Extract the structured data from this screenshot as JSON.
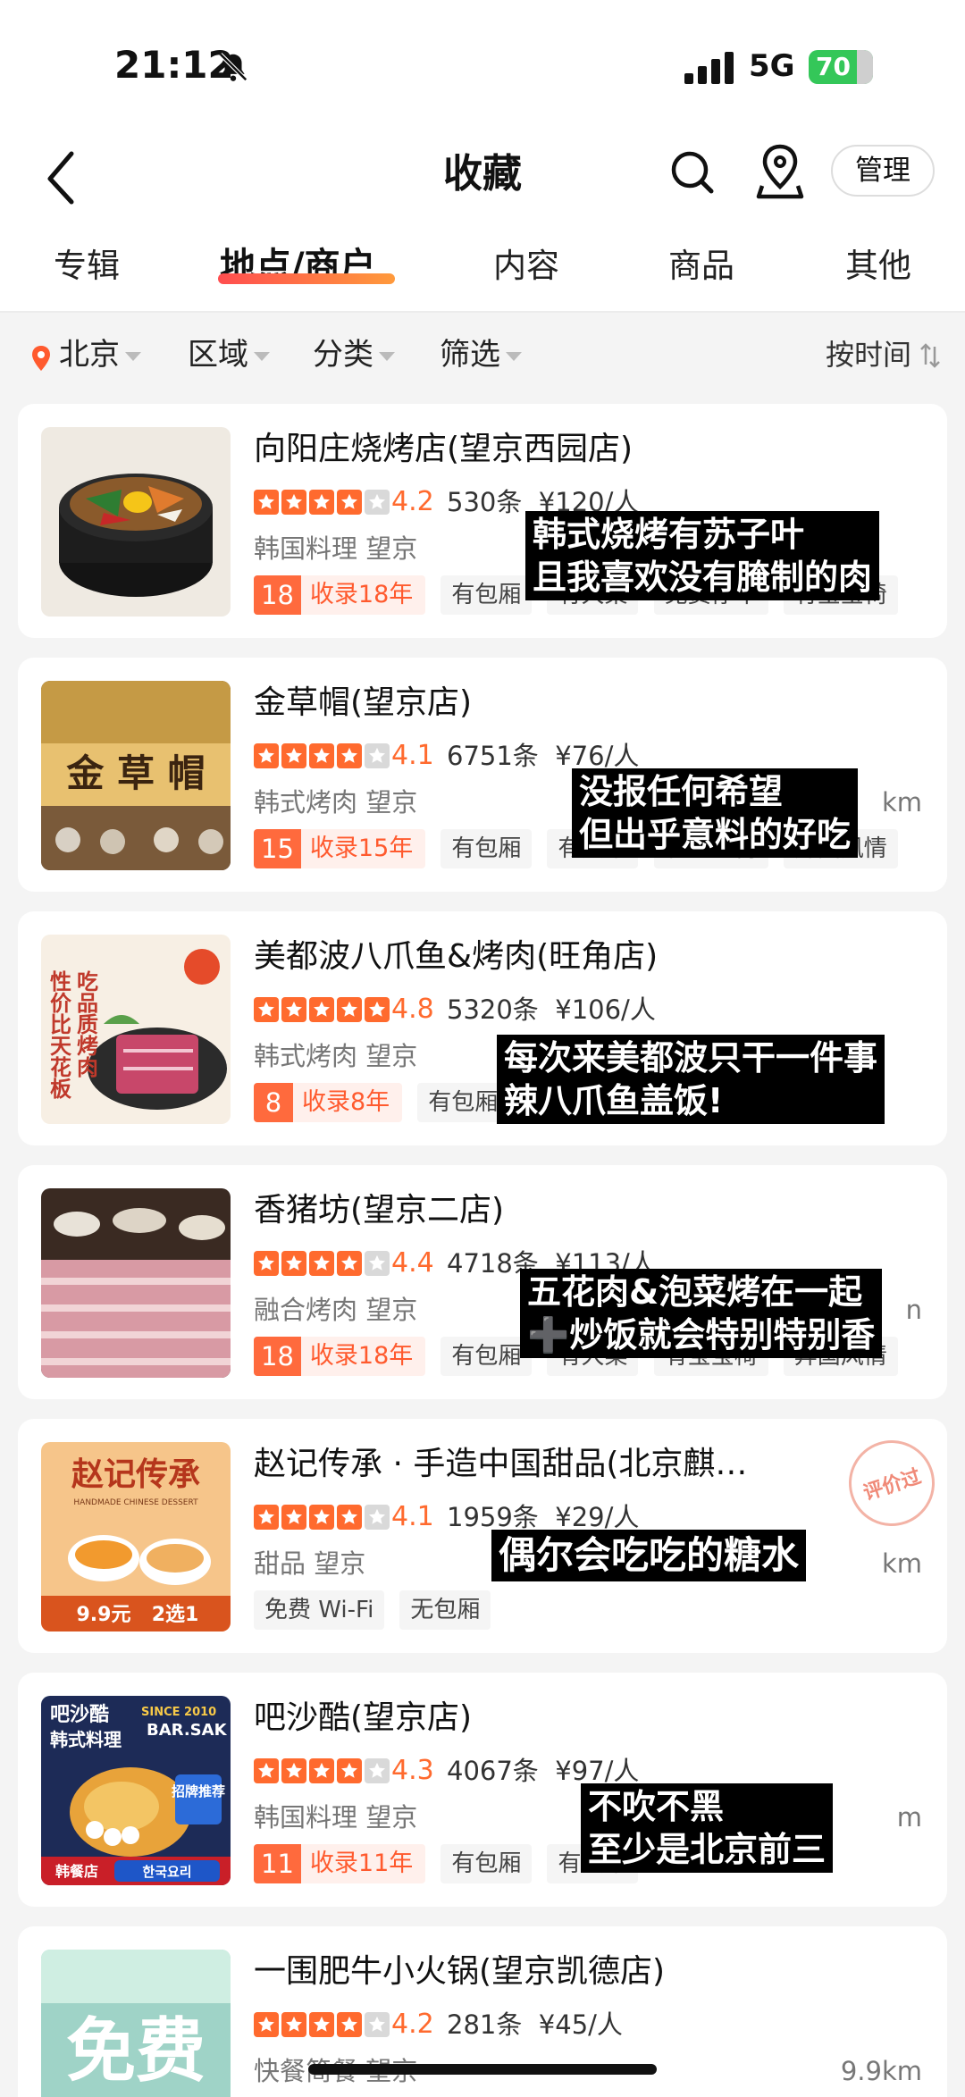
{
  "status": {
    "time": "21:12",
    "network": "5G",
    "battery": "70"
  },
  "nav": {
    "title": "收藏",
    "manage": "管理"
  },
  "tabs": [
    "专辑",
    "地点/商户",
    "内容",
    "商品",
    "其他"
  ],
  "filter": {
    "city": "北京",
    "area": "区域",
    "category": "分类",
    "filter": "筛选",
    "sort": "按时间"
  },
  "stores": [
    {
      "name": "向阳庄烧烤店(望京西园店)",
      "rating": "4.2",
      "stars": 4,
      "reviews": "530条",
      "price": "¥120/人",
      "category": "韩国料理 望京",
      "distance": "",
      "years_num": "18",
      "years_text": "收录18年",
      "tags": [
        "有包厢",
        "有大桌",
        "免费停车",
        "有宝宝椅"
      ],
      "caption": [
        "韩式烧烤有苏子叶",
        "且我喜欢没有腌制的肉"
      ]
    },
    {
      "name": "金草帽(望京店)",
      "rating": "4.1",
      "stars": 4,
      "reviews": "6751条",
      "price": "¥76/人",
      "category": "韩式烤肉 望京",
      "distance": "km",
      "years_num": "15",
      "years_text": "收录15年",
      "tags": [
        "有包厢",
        "有大桌",
        "有宝宝椅",
        "异国风情"
      ],
      "caption": [
        "没报任何希望",
        "但出乎意料的好吃"
      ]
    },
    {
      "name": "美都波八爪鱼&烤肉(旺角店)",
      "rating": "4.8",
      "stars": 5,
      "reviews": "5320条",
      "price": "¥106/人",
      "category": "韩式烤肉 望京",
      "distance": "",
      "years_num": "8",
      "years_text": "收录8年",
      "tags": [
        "有包厢"
      ],
      "caption": [
        "每次来美都波只干一件事",
        "辣八爪鱼盖饭!"
      ]
    },
    {
      "name": "香猪坊(望京二店)",
      "rating": "4.4",
      "stars": 4,
      "reviews": "4718条",
      "price": "¥113/人",
      "category": "融合烤肉 望京",
      "distance": "n",
      "years_num": "18",
      "years_text": "收录18年",
      "tags": [
        "有包厢",
        "有大桌",
        "有宝宝椅",
        "异国风情"
      ],
      "caption": [
        "五花肉&泡菜烤在一起",
        "➕炒饭就会特别特别香"
      ]
    },
    {
      "name": "赵记传承 · 手造中国甜品(北京麒…",
      "rating": "4.1",
      "stars": 4,
      "reviews": "1959条",
      "price": "¥29/人",
      "category": "甜品 望京",
      "distance": "km",
      "tags": [
        "免费 Wi-Fi",
        "无包厢"
      ],
      "caption": [
        "偶尔会吃吃的糖水"
      ],
      "stamp": "评价过"
    },
    {
      "name": "吧沙酷(望京店)",
      "rating": "4.3",
      "stars": 4,
      "reviews": "4067条",
      "price": "¥97/人",
      "category": "韩国料理 望京",
      "distance": "m",
      "years_num": "11",
      "years_text": "收录11年",
      "tags": [
        "有包厢",
        "有大桌"
      ],
      "caption": [
        "不吹不黑",
        "至少是北京前三"
      ]
    },
    {
      "name": "一围肥牛小火锅(望京凯德店)",
      "rating": "4.2",
      "stars": 4,
      "reviews": "281条",
      "price": "¥45/人",
      "category": "快餐简餐 望京",
      "distance": "9.9km"
    }
  ],
  "thumb_text": {
    "t2": "金 草 帽",
    "t3": [
      "性价比天花板",
      "吃品质烤肉"
    ],
    "t5": {
      "title": "赵记传承",
      "sub": "HANDMADE CHINESE DESSERT",
      "price": "9.9元",
      "deal": "2选1"
    },
    "t6": {
      "name": "吧沙酷",
      "type": "韩式料理",
      "since": "SINCE 2010",
      "en": "BAR.SAK",
      "rec": "招牌推荐",
      "foot1": "韩餐店",
      "foot2": "한국요리"
    },
    "t7": "免费"
  },
  "colors": {
    "accent": "#ff6a2e",
    "badge": "#ff6a3d"
  }
}
